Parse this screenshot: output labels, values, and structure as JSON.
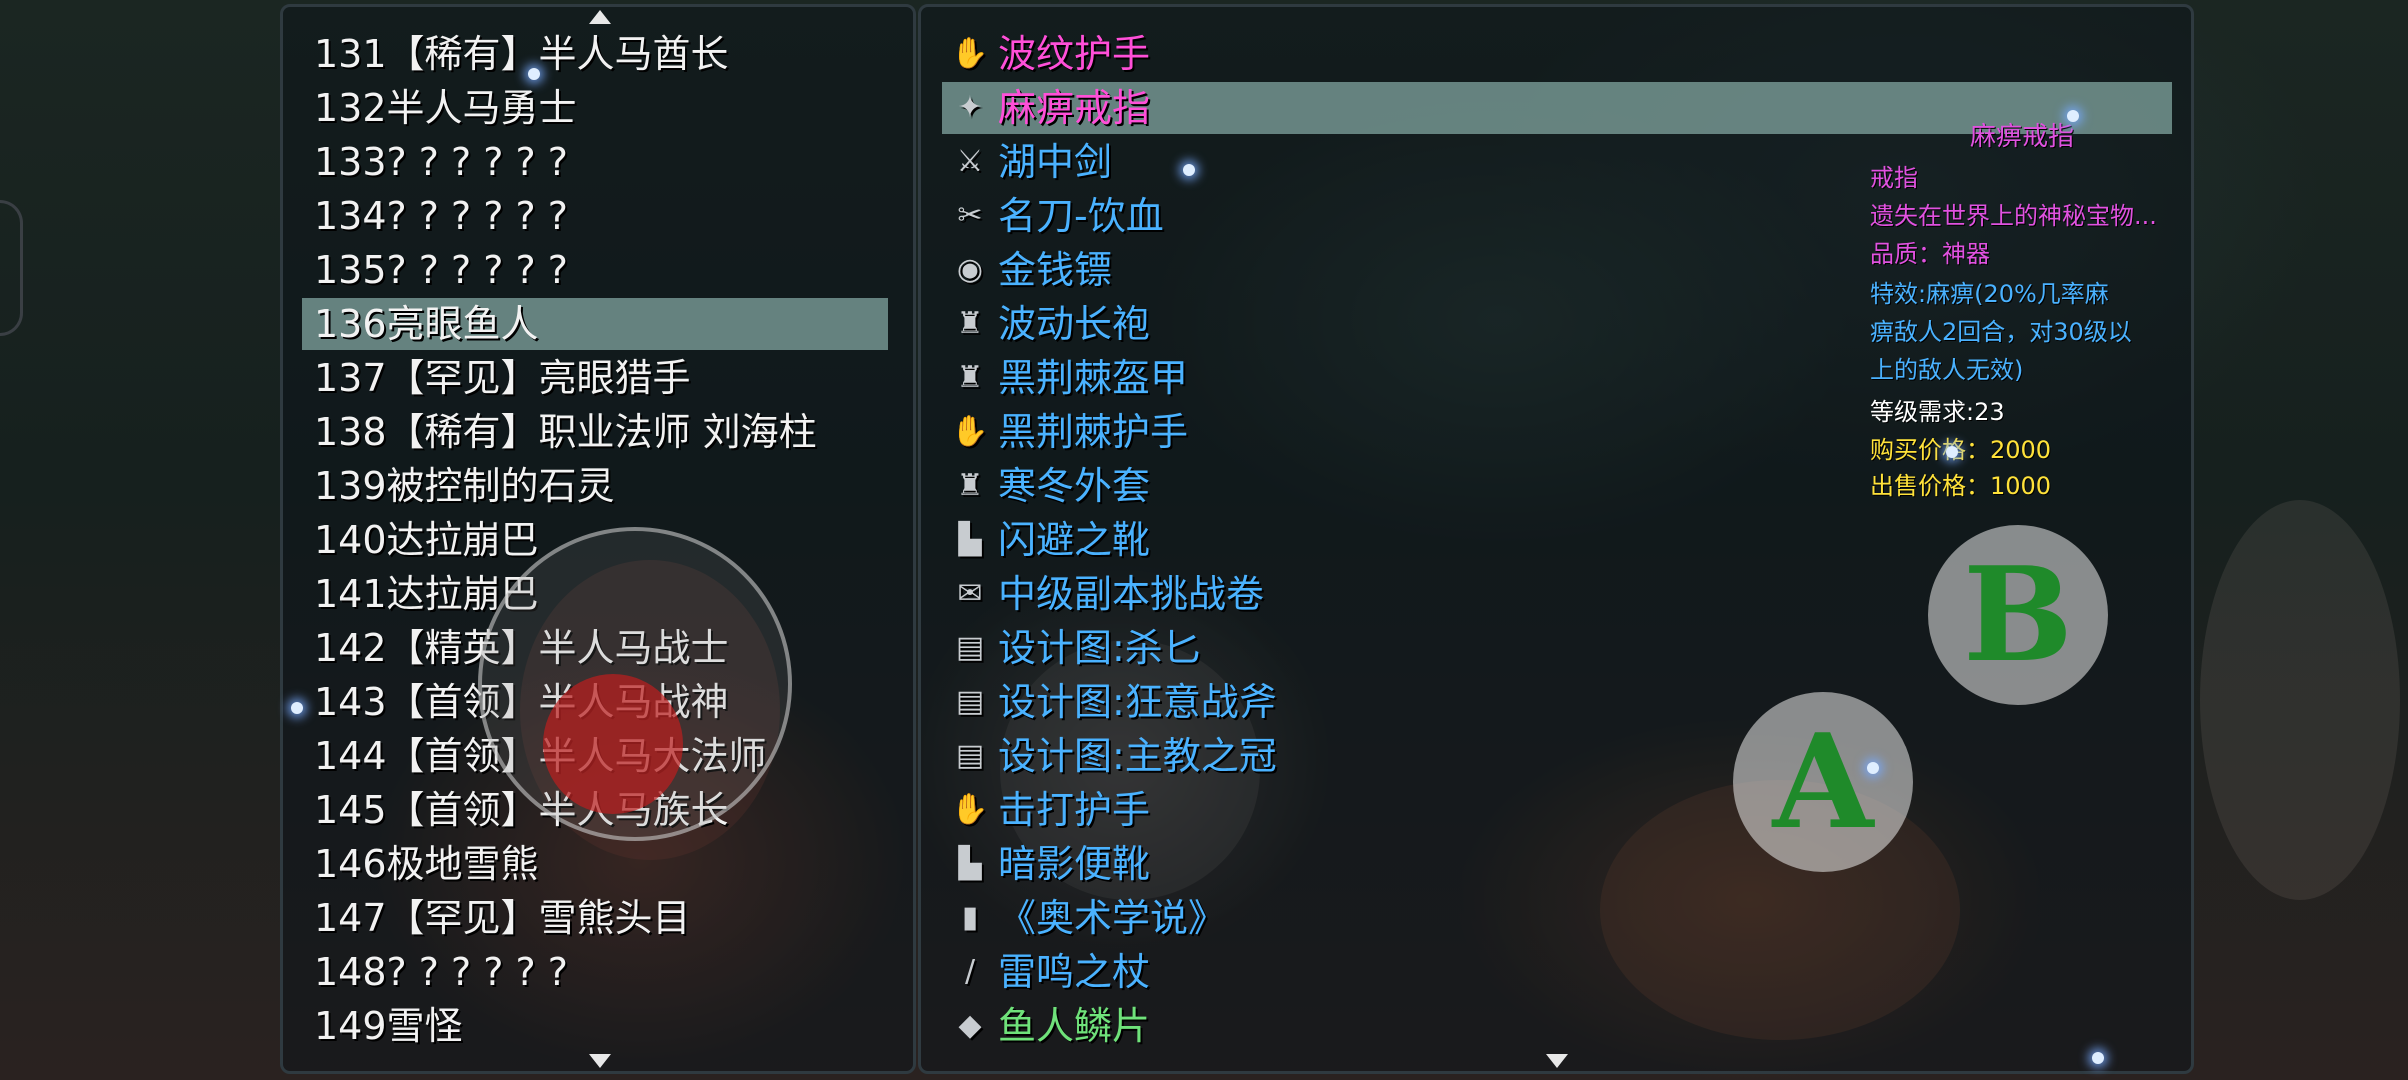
{
  "monster_list": {
    "items": [
      {
        "label": "131【稀有】半人马酋长"
      },
      {
        "label": "132半人马勇士"
      },
      {
        "label": "133? ? ? ? ? ?"
      },
      {
        "label": "134? ? ? ? ? ?"
      },
      {
        "label": "135? ? ? ? ? ?"
      },
      {
        "label": "136亮眼鱼人",
        "selected": true
      },
      {
        "label": "137【罕见】亮眼猎手"
      },
      {
        "label": "138【稀有】职业法师 刘海柱"
      },
      {
        "label": "139被控制的石灵"
      },
      {
        "label": "140达拉崩巴"
      },
      {
        "label": "141达拉崩巴"
      },
      {
        "label": "142【精英】半人马战士"
      },
      {
        "label": "143【首领】半人马战神"
      },
      {
        "label": "144【首领】半人马大法师"
      },
      {
        "label": "145【首领】半人马族长"
      },
      {
        "label": "146极地雪熊"
      },
      {
        "label": "147【罕见】雪熊头目"
      },
      {
        "label": "148? ? ? ? ? ?"
      },
      {
        "label": "149雪怪"
      }
    ]
  },
  "item_list": {
    "items": [
      {
        "label": "波纹护手",
        "color": "#ff4fd8",
        "icon": "gauntlet-icon",
        "glyph": "✋"
      },
      {
        "label": "麻痹戒指",
        "color": "#ff4fd8",
        "icon": "ring-icon",
        "glyph": "✦",
        "selected": true
      },
      {
        "label": "湖中剑",
        "color": "#4ab2ff",
        "icon": "sword-icon",
        "glyph": "⚔"
      },
      {
        "label": "名刀-饮血",
        "color": "#4ab2ff",
        "icon": "blade-icon",
        "glyph": "✂"
      },
      {
        "label": "金钱镖",
        "color": "#4ab2ff",
        "icon": "coin-icon",
        "glyph": "◉"
      },
      {
        "label": "波动长袍",
        "color": "#4ab2ff",
        "icon": "robe-icon",
        "glyph": "♜"
      },
      {
        "label": "黑荆棘盔甲",
        "color": "#4ab2ff",
        "icon": "armor-icon",
        "glyph": "♜"
      },
      {
        "label": "黑荆棘护手",
        "color": "#4ab2ff",
        "icon": "glove-icon",
        "glyph": "✋"
      },
      {
        "label": "寒冬外套",
        "color": "#4ab2ff",
        "icon": "coat-icon",
        "glyph": "♜"
      },
      {
        "label": "闪避之靴",
        "color": "#4ab2ff",
        "icon": "boot-icon",
        "glyph": "▙"
      },
      {
        "label": "中级副本挑战卷",
        "color": "#4ab2ff",
        "icon": "scroll-icon",
        "glyph": "✉"
      },
      {
        "label": "设计图:杀匕",
        "color": "#4ab2ff",
        "icon": "blueprint-icon",
        "glyph": "▤"
      },
      {
        "label": "设计图:狂意战斧",
        "color": "#4ab2ff",
        "icon": "blueprint-icon",
        "glyph": "▤"
      },
      {
        "label": "设计图:主教之冠",
        "color": "#4ab2ff",
        "icon": "blueprint-icon",
        "glyph": "▤"
      },
      {
        "label": "击打护手",
        "color": "#4ab2ff",
        "icon": "gauntlet-icon",
        "glyph": "✋"
      },
      {
        "label": "暗影便靴",
        "color": "#4ab2ff",
        "icon": "boot-icon",
        "glyph": "▙"
      },
      {
        "label": "《奥术学说》",
        "color": "#4ab2ff",
        "icon": "book-icon",
        "glyph": "▮"
      },
      {
        "label": "雷鸣之杖",
        "color": "#4ab2ff",
        "icon": "staff-icon",
        "glyph": "/"
      },
      {
        "label": "鱼人鳞片",
        "color": "#6fe27a",
        "icon": "scale-icon",
        "glyph": "◆"
      }
    ]
  },
  "detail": {
    "name": "麻痹戒指",
    "type": "戒指",
    "description": "遗失在世界上的神秘宝物...",
    "quality": "品质：神器",
    "effect_line1": "特效:麻痹(20%几率麻",
    "effect_line2": "痹敌人2回合，对30级以",
    "effect_line3": "上的敌人无效)",
    "level_req": "等级需求:23",
    "buy_price": "购买价格：2000",
    "sell_price": "出售价格：1000",
    "colors": {
      "name": "#e052e0",
      "type": "#e052e0",
      "description": "#e052e0",
      "quality": "#e052e0",
      "effect": "#4ab2ff",
      "level": "#ffffff",
      "price": "#ffe23a"
    }
  },
  "controls": {
    "a_label": "A",
    "b_label": "B"
  }
}
